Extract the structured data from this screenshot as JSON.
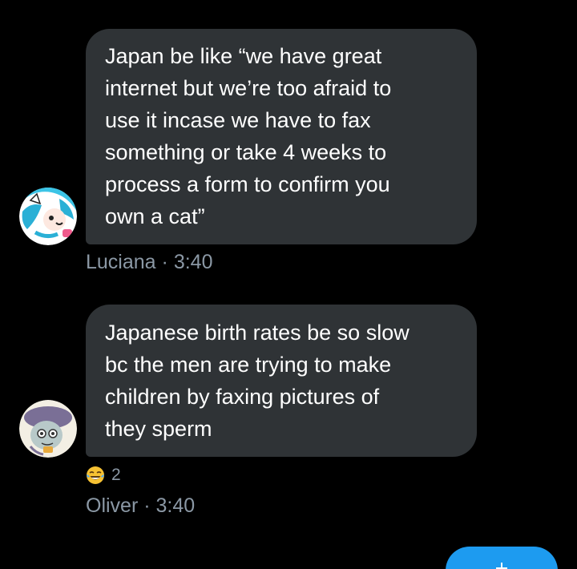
{
  "messages": [
    {
      "author": "Luciana",
      "time": "3:40",
      "lines": [
        "Japan be like “we have great",
        "internet but we’re too afraid to",
        "use it incase we have to fax",
        "something or take 4 weeks to",
        "process a form to confirm you",
        "own a cat”"
      ]
    },
    {
      "author": "Oliver",
      "time": "3:40",
      "lines": [
        "Japanese birth rates be so slow",
        "bc the men are trying to make",
        "children by faxing pictures of",
        "they sperm"
      ],
      "reaction": {
        "icon": "tears-of-joy-emoji-icon",
        "count": "2"
      }
    }
  ],
  "separator": "·",
  "compose_button": {
    "icon": "plus-icon",
    "color": "#1d9bf0"
  },
  "colors": {
    "background": "#000000",
    "bubble": "#2f3336",
    "meta_text": "#8b98a5"
  }
}
